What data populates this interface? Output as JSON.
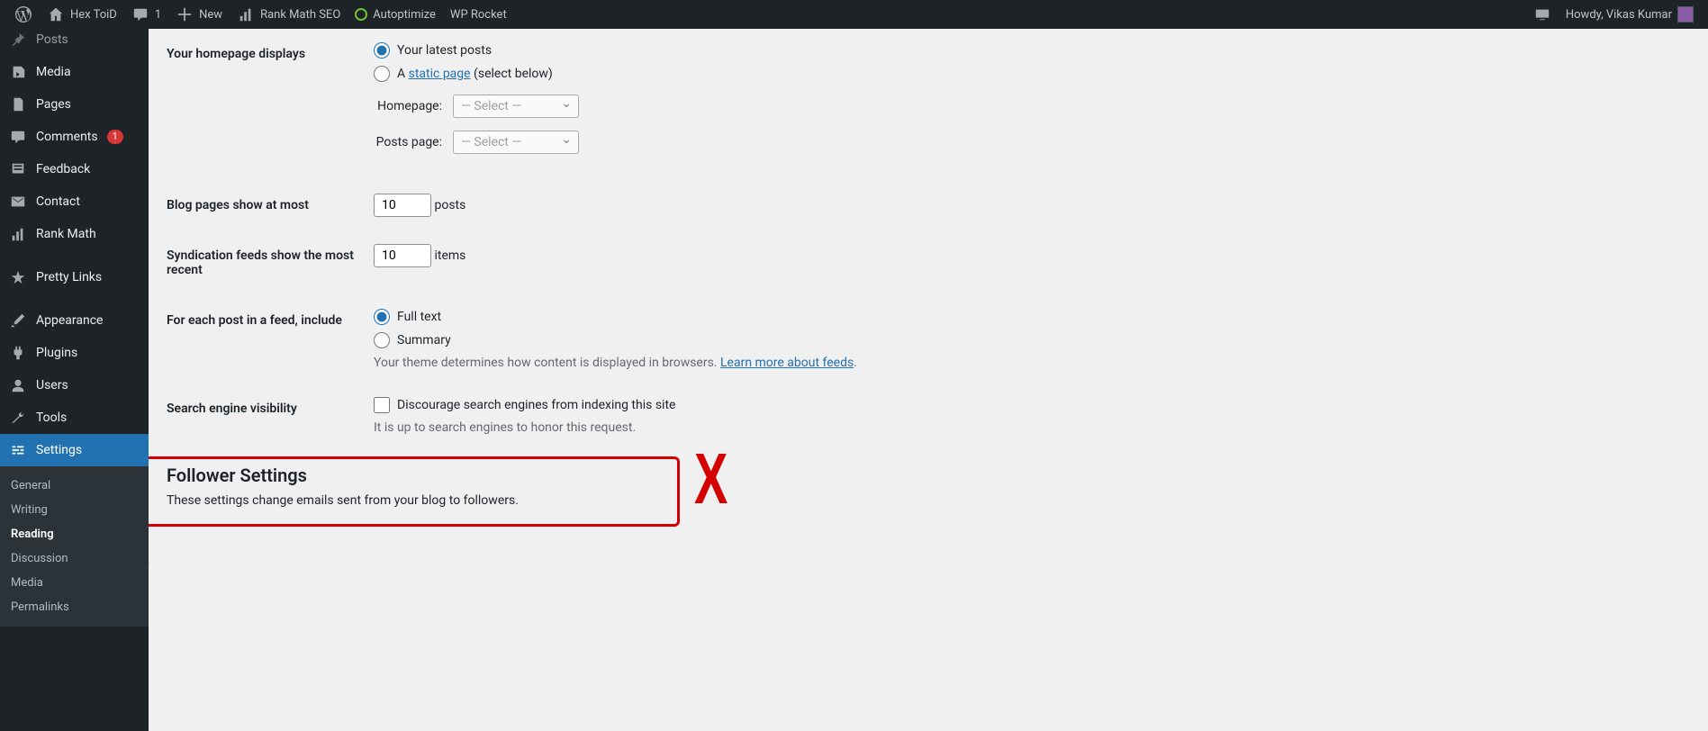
{
  "adminbar": {
    "site_name": "Hex ToiD",
    "comment_count": "1",
    "new_label": "New",
    "rankmath": "Rank Math SEO",
    "autoptimize": "Autoptimize",
    "wprocket": "WP Rocket",
    "howdy": "Howdy, Vikas Kumar"
  },
  "sidebar": {
    "posts": "Posts",
    "media": "Media",
    "pages": "Pages",
    "comments": "Comments",
    "comments_badge": "1",
    "feedback": "Feedback",
    "contact": "Contact",
    "rankmath": "Rank Math",
    "prettylinks": "Pretty Links",
    "appearance": "Appearance",
    "plugins": "Plugins",
    "users": "Users",
    "tools": "Tools",
    "settings": "Settings"
  },
  "submenu": {
    "general": "General",
    "writing": "Writing",
    "reading": "Reading",
    "discussion": "Discussion",
    "media": "Media",
    "permalinks": "Permalinks"
  },
  "form": {
    "homepage_displays_label": "Your homepage displays",
    "latest_posts": "Your latest posts",
    "static_page_prefix": "A ",
    "static_page_link": "static page",
    "static_page_suffix": " (select below)",
    "homepage_label": "Homepage:",
    "postspage_label": "Posts page:",
    "select_placeholder": "— Select —",
    "blog_pages_label": "Blog pages show at most",
    "blog_pages_value": "10",
    "blog_pages_suffix": "posts",
    "syndication_label": "Syndication feeds show the most recent",
    "syndication_value": "10",
    "syndication_suffix": "items",
    "feed_include_label": "For each post in a feed, include",
    "fulltext": "Full text",
    "summary": "Summary",
    "feed_desc_prefix": "Your theme determines how content is displayed in browsers. ",
    "feed_desc_link": "Learn more about feeds",
    "sev_label": "Search engine visibility",
    "sev_checkbox": "Discourage search engines from indexing this site",
    "sev_desc": "It is up to search engines to honor this request.",
    "follower_heading": "Follower Settings",
    "follower_desc": "These settings change emails sent from your blog to followers."
  }
}
